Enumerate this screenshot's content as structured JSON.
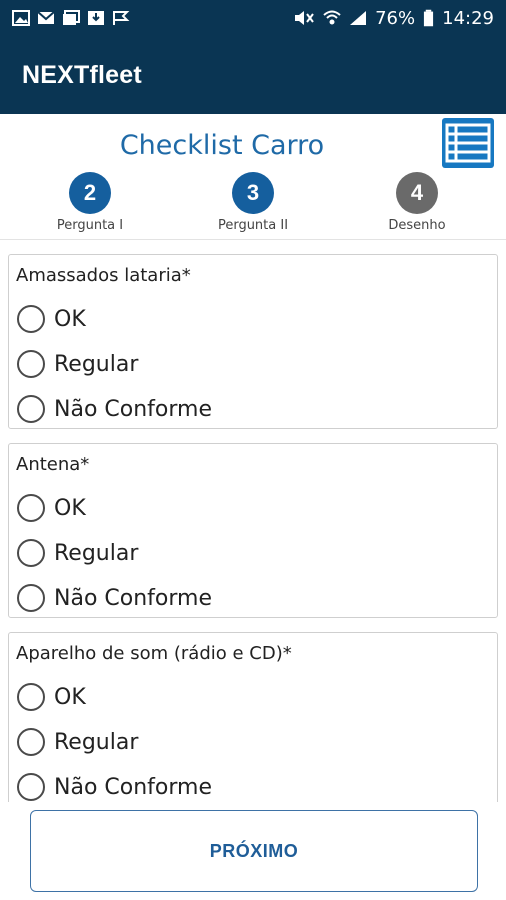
{
  "status_bar": {
    "battery": "76%",
    "time": "14:29"
  },
  "app": {
    "title": "NEXTfleet"
  },
  "header": {
    "title": "Checklist Carro",
    "steps": [
      {
        "number": "2",
        "label": "Pergunta I",
        "state": "active"
      },
      {
        "number": "3",
        "label": "Pergunta II",
        "state": "active"
      },
      {
        "number": "4",
        "label": "Desenho",
        "state": "inactive"
      }
    ]
  },
  "questions": [
    {
      "label": "Amassados lataria*",
      "options": [
        "OK",
        "Regular",
        "Não Conforme"
      ]
    },
    {
      "label": "Antena*",
      "options": [
        "OK",
        "Regular",
        "Não Conforme"
      ]
    },
    {
      "label": "Aparelho de som (rádio e CD)*",
      "options": [
        "OK",
        "Regular",
        "Não Conforme"
      ]
    }
  ],
  "footer": {
    "next_label": "PRÓXIMO"
  },
  "colors": {
    "appbar": "#0a3553",
    "accent": "#1f6aa7",
    "step_active": "#155f9e",
    "step_inactive": "#6a6a6a"
  }
}
